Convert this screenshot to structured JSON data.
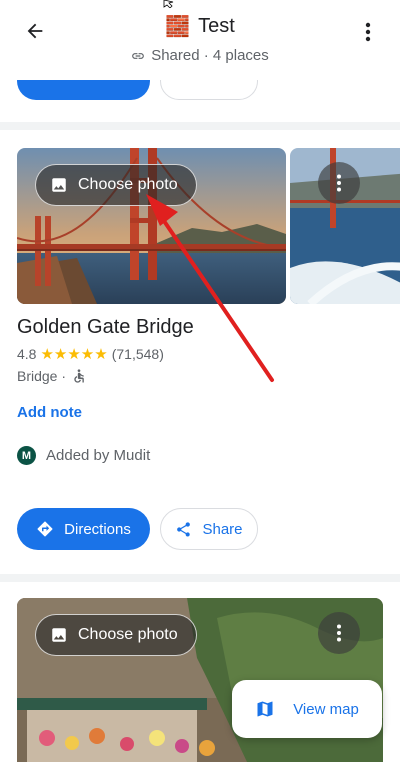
{
  "header": {
    "title": "Test",
    "list_emoji": "🧱",
    "subtitle": "Shared · 4 places",
    "accent_color": "#f6e9b4"
  },
  "place_card": {
    "choose_photo_label": "Choose photo",
    "name": "Golden Gate Bridge",
    "rating": "4.8",
    "rating_stars": 4.8,
    "review_count": "(71,548)",
    "category": "Bridge ·",
    "accessibility_icon": "wheelchair-icon",
    "add_note_label": "Add note",
    "added_by_initial": "M",
    "added_by_text": "Added by Mudit",
    "directions_label": "Directions",
    "share_label": "Share"
  },
  "next_card": {
    "choose_photo_label": "Choose photo"
  },
  "floating": {
    "view_map_label": "View map"
  },
  "colors": {
    "brand_blue": "#1a73e8",
    "star_yellow": "#fbbc04",
    "annotation_red": "#e0201f"
  }
}
